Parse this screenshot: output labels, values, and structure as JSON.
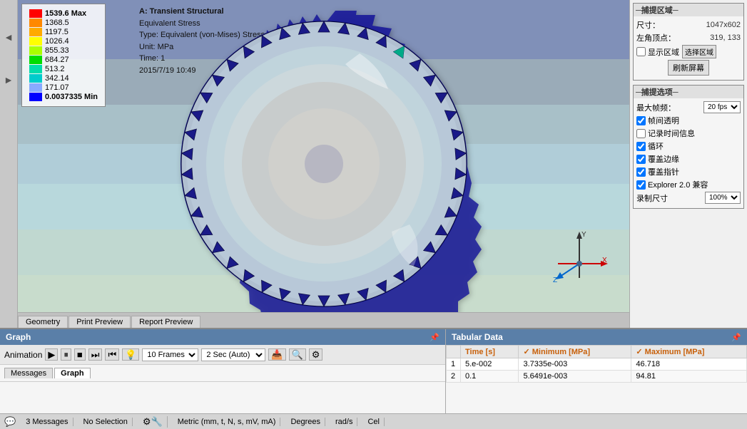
{
  "header": {
    "title": "A: Transient Structural",
    "stress_type": "Equivalent Stress",
    "type_label": "Type: Equivalent (von-Mises) Stress",
    "unit_label": "Unit: MPa",
    "time_label": "Time: 1",
    "date_label": "2015/7/19 10:49"
  },
  "legend": {
    "max_label": "1539.6 Max",
    "val2": "1368.5",
    "val3": "1197.5",
    "val4": "1026.4",
    "val5": "855.33",
    "val6": "684.27",
    "val7": "513.2",
    "val8": "342.14",
    "val9": "171.07",
    "min_label": "0.0037335 Min"
  },
  "right_panel": {
    "capture_section_title": "─捕提区域─",
    "size_label": "尺寸：",
    "size_value": "1047x602",
    "corner_label": "左角顶点：",
    "corner_value": "319, 133",
    "show_region_label": "显示区域",
    "select_region_label": "选择区域",
    "refresh_label": "刷新屏幕",
    "capture_options_title": "─捕提选项─",
    "max_fps_label": "最大帧频：",
    "max_fps_value": "20 fps",
    "frame_transparent_label": "帧间透明",
    "record_time_label": "记录时间信息",
    "loop_label": "循环",
    "cover_edge_label": "覆盖边缘",
    "cover_cursor_label": "覆盖指针",
    "explorer_compat_label": "Explorer 2.0 兼容",
    "record_size_label": "录制尺寸",
    "record_size_value": "100%"
  },
  "tabs": {
    "geometry": "Geometry",
    "print_preview": "Print Preview",
    "report_preview": "Report Preview"
  },
  "graph_panel": {
    "title": "Graph",
    "pin_icon": "📌",
    "animation_label": "Animation",
    "frames_value": "10 Frames",
    "time_value": "2 Sec (Auto)",
    "tabs": {
      "messages": "Messages",
      "graph": "Graph"
    }
  },
  "tabular_panel": {
    "title": "Tabular Data",
    "pin_icon": "📌",
    "columns": [
      "Time [s]",
      "Minimum [MPa]",
      "Maximum [MPa]"
    ],
    "rows": [
      {
        "row_num": "1",
        "time": "5.e-002",
        "min": "3.7335e-003",
        "max": "46.718"
      },
      {
        "row_num": "2",
        "time": "0.1",
        "min": "5.6491e-003",
        "max": "94.81"
      }
    ]
  },
  "status_bar": {
    "messages": "3 Messages",
    "selection": "No Selection",
    "metric": "Metric (mm, t, N, s, mV, mA)",
    "degrees": "Degrees",
    "radians": "rad/s",
    "celsius": "Cel"
  }
}
